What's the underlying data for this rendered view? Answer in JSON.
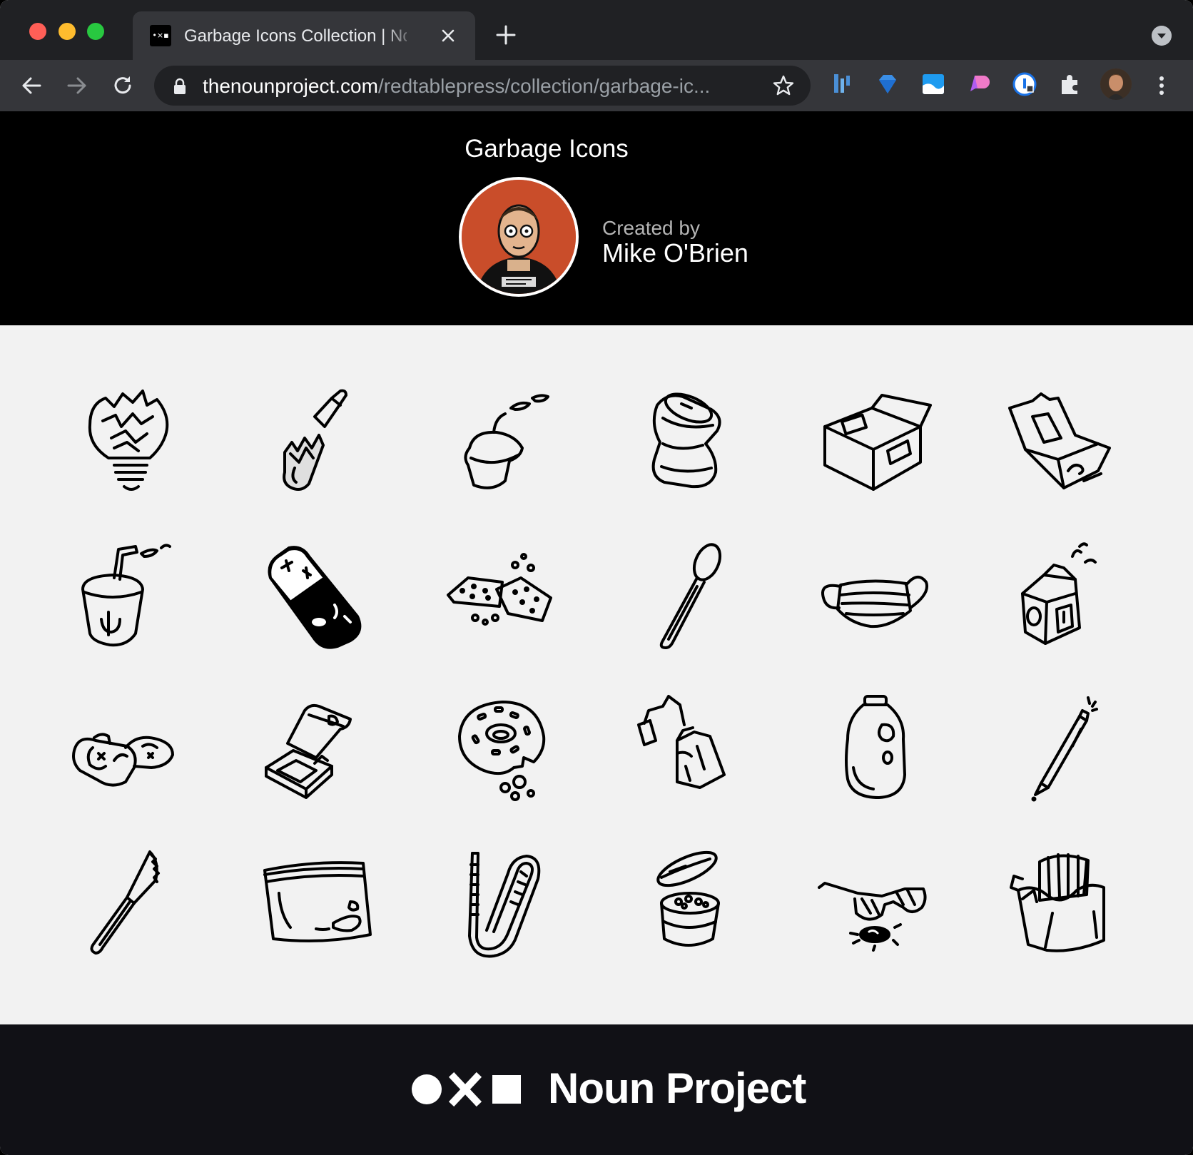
{
  "browser": {
    "tab_title": "Garbage Icons Collection | Noun Project",
    "url_host": "thenounproject.com",
    "url_path": "/redtablepress/collection/garbage-ic...",
    "favicon_text": "•×▪"
  },
  "header": {
    "title": "Garbage Icons",
    "created_by_label": "Created by",
    "author": "Mike O'Brien"
  },
  "icons": [
    "broken-light-bulb-icon",
    "broken-bottle-icon",
    "spilled-coffee-cup-icon",
    "crushed-can-icon",
    "cardboard-box-icon",
    "takeout-box-icon",
    "soda-cup-icon",
    "battery-icon",
    "crackers-icon",
    "spoon-icon",
    "face-mask-icon",
    "milk-carton-icon",
    "candy-wrappers-icon",
    "food-tray-icon",
    "donut-icon",
    "tea-bag-icon",
    "jug-icon",
    "pen-icon",
    "plastic-knife-icon",
    "ziplock-bag-icon",
    "straw-icon",
    "yogurt-cup-icon",
    "sunglasses-icon",
    "fries-box-icon"
  ],
  "footer": {
    "brand": "Noun Project"
  }
}
